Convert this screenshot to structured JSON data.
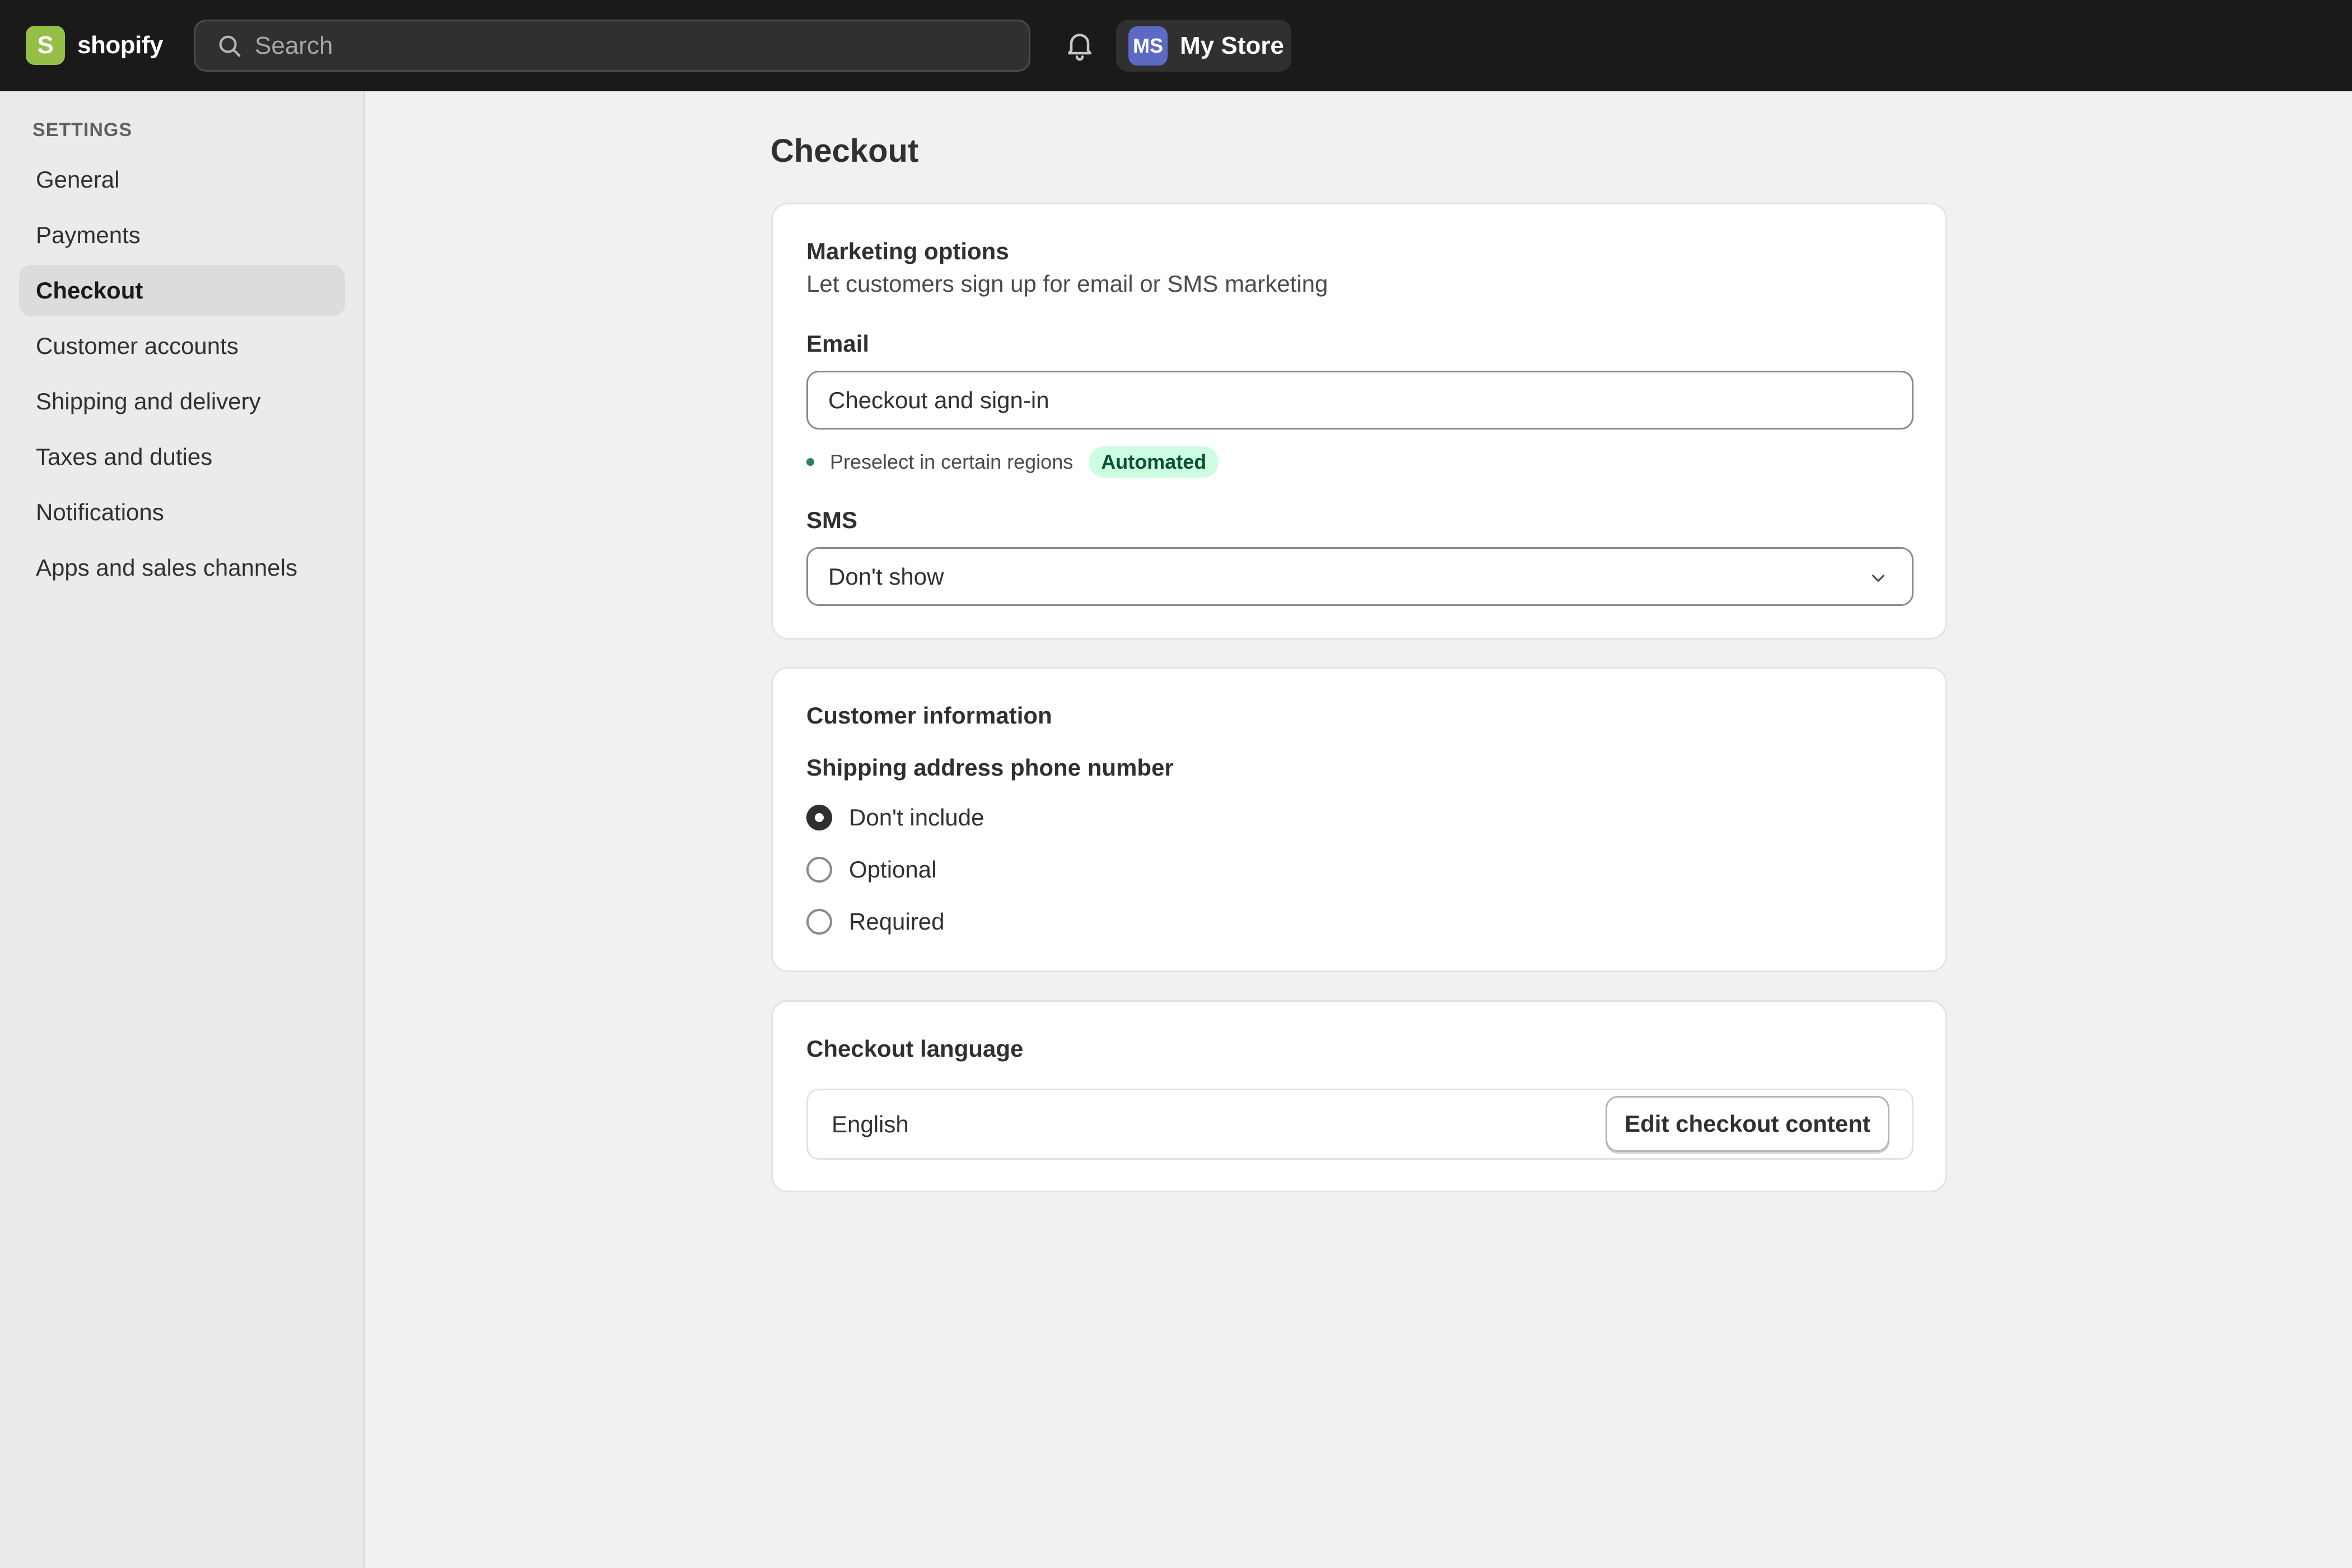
{
  "topbar": {
    "brand_logo_letter": "S",
    "brand_name": "shopify",
    "search_placeholder": "Search",
    "store_initials": "MS",
    "store_name": "My Store"
  },
  "sidebar": {
    "heading": "SETTINGS",
    "items": [
      {
        "label": "General",
        "active": false
      },
      {
        "label": "Payments",
        "active": false
      },
      {
        "label": "Checkout",
        "active": true
      },
      {
        "label": "Customer accounts",
        "active": false
      },
      {
        "label": "Shipping and delivery",
        "active": false
      },
      {
        "label": "Taxes and duties",
        "active": false
      },
      {
        "label": "Notifications",
        "active": false
      },
      {
        "label": "Apps and sales channels",
        "active": false
      }
    ]
  },
  "main": {
    "page_title": "Checkout",
    "marketing": {
      "title": "Marketing options",
      "subtitle": "Let customers sign up for email or SMS marketing",
      "email_label": "Email",
      "email_value": "Checkout and sign-in",
      "hint_text": "Preselect in certain regions",
      "badge": "Automated",
      "sms_label": "SMS",
      "sms_value": "Don't show"
    },
    "customer_info": {
      "title": "Customer information",
      "group_label": "Shipping address phone number",
      "options": [
        {
          "label": "Don't include",
          "checked": true
        },
        {
          "label": "Optional",
          "checked": false
        },
        {
          "label": "Required",
          "checked": false
        }
      ]
    },
    "language": {
      "title": "Checkout language",
      "value": "English",
      "edit_button": "Edit checkout content"
    }
  },
  "colors": {
    "topbar_bg": "#1a1a1a",
    "brand_green": "#95bf47",
    "avatar_bg": "#5c6ac4",
    "badge_bg": "#cdfee1",
    "badge_text": "#0c5132",
    "success_dot": "#29845a"
  },
  "icons": {
    "search": "search-icon",
    "notifications": "bell-icon",
    "select": "chevron-down-icon"
  }
}
